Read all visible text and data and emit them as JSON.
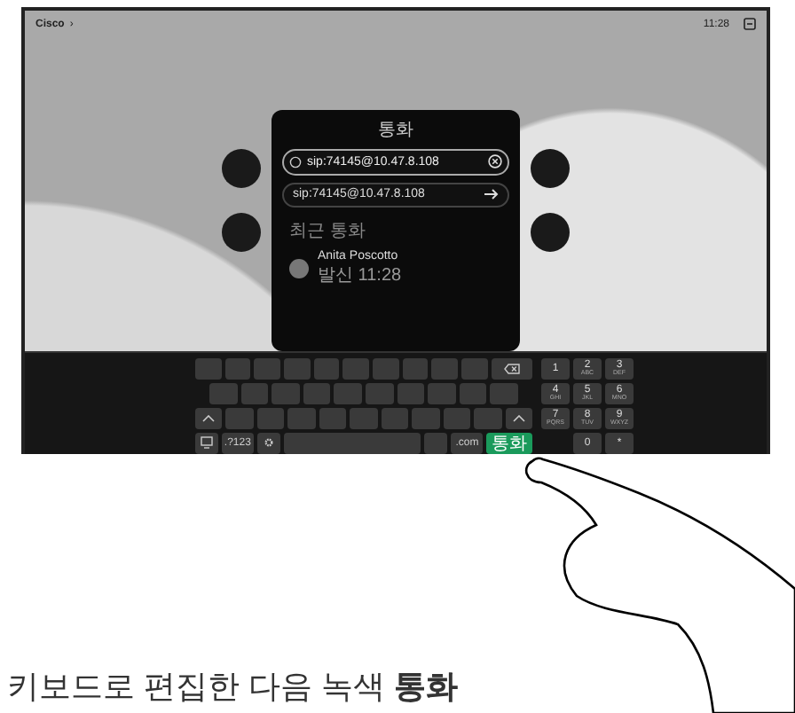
{
  "top_bar": {
    "brand": "Cisco",
    "chevron": "›",
    "time": "11:28"
  },
  "call_dialog": {
    "title": "통화",
    "search": {
      "value": "sip:74145@10.47.8.108"
    },
    "suggestion": {
      "text": "sip:74145@10.47.8.108"
    },
    "recent_label": "최근 통화",
    "recent": [
      {
        "name": "Anita Poscotto",
        "detail": "발신 11:28"
      }
    ]
  },
  "keyboard": {
    "rows": [
      [
        {
          "kind": "key"
        },
        {
          "kind": "key"
        },
        {
          "kind": "key"
        },
        {
          "kind": "key"
        },
        {
          "kind": "key"
        },
        {
          "kind": "key"
        },
        {
          "kind": "key"
        },
        {
          "kind": "key"
        },
        {
          "kind": "key"
        },
        {
          "kind": "key"
        },
        {
          "kind": "backspace"
        }
      ],
      [
        {
          "kind": "key"
        },
        {
          "kind": "key"
        },
        {
          "kind": "key"
        },
        {
          "kind": "key"
        },
        {
          "kind": "key"
        },
        {
          "kind": "key"
        },
        {
          "kind": "key"
        },
        {
          "kind": "key"
        },
        {
          "kind": "key"
        },
        {
          "kind": "key"
        }
      ],
      [
        {
          "kind": "shift"
        },
        {
          "kind": "key"
        },
        {
          "kind": "key"
        },
        {
          "kind": "key"
        },
        {
          "kind": "key"
        },
        {
          "kind": "key"
        },
        {
          "kind": "key"
        },
        {
          "kind": "key"
        },
        {
          "kind": "key"
        },
        {
          "kind": "key"
        },
        {
          "kind": "shift"
        }
      ],
      [
        {
          "kind": "emoji"
        },
        {
          "kind": "text",
          "label": ".?123"
        },
        {
          "kind": "settings"
        },
        {
          "kind": "space"
        },
        {
          "kind": "key"
        },
        {
          "kind": "text",
          "label": ".com"
        },
        {
          "kind": "call",
          "label": "통화"
        }
      ]
    ],
    "keypad": [
      {
        "digit": "1"
      },
      {
        "digit": "2",
        "letters": "ABC"
      },
      {
        "digit": "3",
        "letters": "DEF"
      },
      {
        "digit": "4",
        "letters": "GHI"
      },
      {
        "digit": "5",
        "letters": "JKL"
      },
      {
        "digit": "6",
        "letters": "MNO"
      },
      {
        "digit": "7",
        "letters": "PQRS"
      },
      {
        "digit": "8",
        "letters": "TUV"
      },
      {
        "digit": "9",
        "letters": "WXYZ"
      },
      {
        "digit": "0"
      },
      {
        "digit": "*"
      }
    ]
  },
  "caption": "키보드로 편집한 다음 녹색 **통화**"
}
